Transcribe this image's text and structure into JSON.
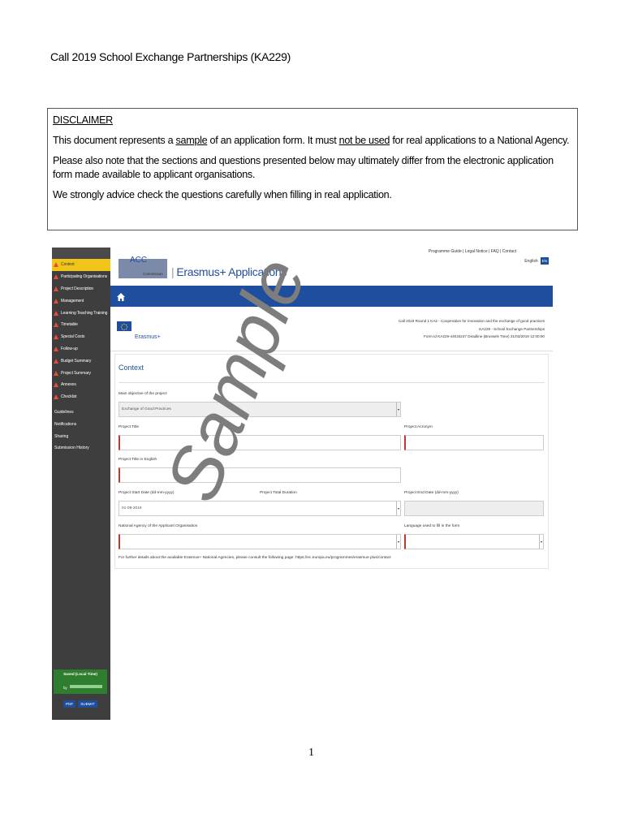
{
  "document": {
    "title": "Call 2019 School Exchange Partnerships (KA229)",
    "page_number": "1",
    "watermark": "Sample"
  },
  "disclaimer": {
    "heading": "DISCLAIMER",
    "p1_a": "This document represents a ",
    "p1_sample": "sample",
    "p1_b": " of an application form. It must ",
    "p1_not": "not be used",
    "p1_c": " for real applications to a National Agency.",
    "p2": "Please also note that the sections and questions presented below may ultimately differ from the electronic application form made available to applicant organisations.",
    "p3": "We strongly advice check the questions carefully when filling in real application."
  },
  "screenshot": {
    "top_links": "Programme Guide | Legal Notice | FAQ | Contact",
    "language": "English",
    "language_code": "EN",
    "logo_text": "ACC",
    "logo_sub": "Commission",
    "app_title": "Erasmus+ Applications",
    "erasmus_label": "Erasmus+",
    "call_lines": [
      "Call 2019  Round 1  KA2 - Cooperation for innovation and the exchange of good practices",
      "KA229 - School Exchange Partnerships",
      "Form Id KA229-44034247  Deadline (Brussels Time) 21/03/2019 12:00:00"
    ],
    "nav_items": [
      "Context",
      "Participating Organisations",
      "Project Description",
      "Management",
      "Learning Teaching Training",
      "Timetable",
      "Special Costs",
      "Follow-up",
      "Budget Summary",
      "Project Summary",
      "Annexes",
      "Checklist"
    ],
    "sub_items": [
      "Guidelines",
      "Notifications",
      "Sharing",
      "Submission History"
    ],
    "saved_label": "Saved (Local Time)",
    "saved_by": "by",
    "pdf_button": "PDF",
    "submit_button": "SUBMIT",
    "section_title": "Context",
    "form": {
      "main_objective_label": "Main objective of the project",
      "main_objective_value": "Exchange of Good Practices",
      "project_title_label": "Project Title",
      "project_acronym_label": "Project Acronym",
      "title_english_label": "Project Title in English",
      "start_date_label": "Project Start Date (dd-mm-yyyy)",
      "start_date_value": "01-09-2019",
      "duration_label": "Project Total Duration",
      "end_date_label": "Project End Date (dd-mm-yyyy)",
      "national_agency_label": "National Agency of the Applicant Organisation",
      "language_label": "Language used to fill in the form",
      "note": "For further details about the available Erasmus+ National Agencies, please consult the following page: https://ec.europa.eu/programmes/erasmus-plus/contact"
    }
  },
  "colors": {
    "brand_blue": "#1f4e9e",
    "sidebar_dark": "#3e3e3e",
    "active_yellow": "#f0c419",
    "required_red": "#c0392b",
    "saved_green": "#2f7d2f"
  }
}
